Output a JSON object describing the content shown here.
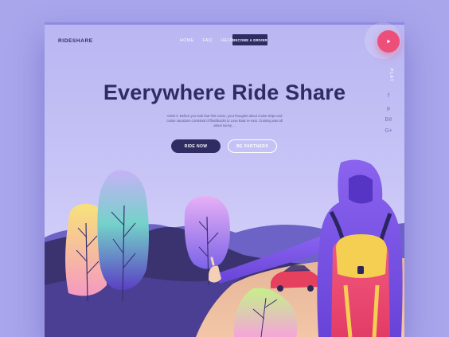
{
  "header": {
    "logo": "RIDESHARE",
    "nav": [
      "HOME",
      "FAQ",
      "HELP"
    ],
    "driver_button": "BECOME A DRIVER"
  },
  "hero": {
    "title": "Everywhere Ride Share",
    "description": "Admit it. Before you took that first cruise, your thoughts about cruise ships and cruise vacations consisted of flashbacks to Love Boat re-runs. Cruising was all about sunny ...",
    "primary_button": "RIDE NOW",
    "secondary_button": "BE PARTNERS"
  },
  "side": {
    "play_label": "PLAY",
    "social": [
      "f",
      "p",
      "Bē",
      "G+"
    ]
  },
  "colors": {
    "background": "#a9a6ec",
    "brand_dark": "#2f2c63",
    "accent_pink": "#ec4f7a",
    "hood_purple": "#7b52e6"
  },
  "icons": [
    "play-icon",
    "facebook-icon",
    "pinterest-icon",
    "behance-icon",
    "google-plus-icon"
  ]
}
